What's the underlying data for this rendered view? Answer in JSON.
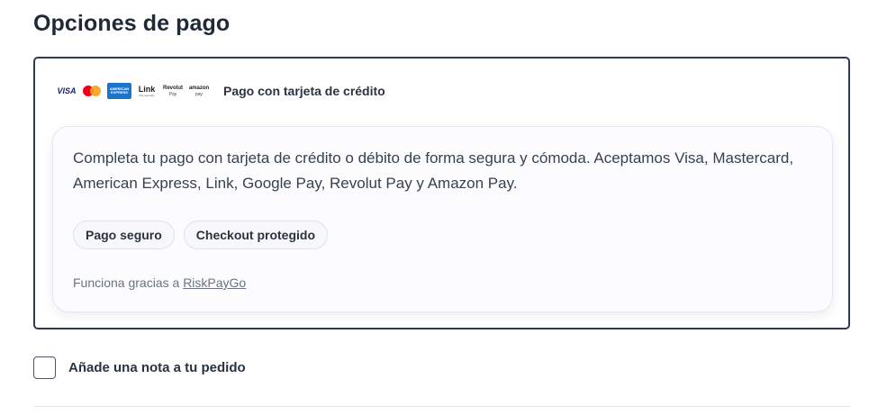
{
  "payment_section": {
    "title": "Opciones de pago"
  },
  "payment_method": {
    "label": "Pago con tarjeta de crédito",
    "brands": [
      {
        "name": "Visa",
        "text": "VISA",
        "icon": "visa-logo"
      },
      {
        "name": "Mastercard",
        "icon": "mastercard-logo"
      },
      {
        "name": "American Express",
        "text_lines": [
          "AMERICAN",
          "EXPRESS"
        ],
        "icon": "amex-logo",
        "color": "#1e74c9"
      },
      {
        "name": "Link",
        "text_lines": [
          "Link",
          "Pay securely"
        ],
        "icon": "link-logo"
      },
      {
        "name": "Revolut Pay",
        "text_lines": [
          "Revolut",
          "Pay"
        ],
        "icon": "revolut-pay-logo"
      },
      {
        "name": "Amazon Pay",
        "text_lines": [
          "amazon",
          "pay"
        ],
        "icon": "amazon-pay-logo"
      }
    ],
    "description": "Completa tu pago con tarjeta de crédito o débito de forma segura y cómoda. Aceptamos Visa, Mastercard, American Express, Link, Google Pay, Revolut Pay y Amazon Pay.",
    "badges": [
      "Pago seguro",
      "Checkout protegido"
    ],
    "powered_by_prefix": "Funciona gracias a",
    "powered_by_link": "RiskPayGo"
  },
  "order_note": {
    "label": "Añade una nota a tu pedido",
    "checked": false
  },
  "colors": {
    "border_selected": "#2f3b4c",
    "text_primary": "#1f2937",
    "amex_blue": "#1e74c9"
  }
}
